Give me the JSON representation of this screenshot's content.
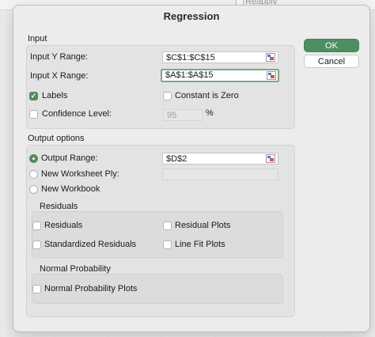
{
  "background": {
    "reapply_label": "Reapply"
  },
  "dialog": {
    "title": "Regression",
    "buttons": {
      "ok": "OK",
      "cancel": "Cancel"
    },
    "input": {
      "section_label": "Input",
      "y_range_label": "Input Y Range:",
      "y_range_value": "$C$1:$C$15",
      "x_range_label": "Input X Range:",
      "x_range_value": "$A$1:$A$15",
      "labels_label": "Labels",
      "labels_checked": true,
      "constant_zero_label": "Constant is Zero",
      "constant_zero_checked": false,
      "confidence_label": "Confidence Level:",
      "confidence_checked": false,
      "confidence_value": "95",
      "percent_sign": "%"
    },
    "output": {
      "section_label": "Output options",
      "output_range_label": "Output Range:",
      "output_range_value": "$D$2",
      "output_range_selected": true,
      "new_ply_label": "New Worksheet Ply:",
      "new_ply_value": "",
      "new_workbook_label": "New Workbook"
    },
    "residuals": {
      "section_label": "Residuals",
      "residuals_label": "Residuals",
      "residual_plots_label": "Residual Plots",
      "standardized_label": "Standardized Residuals",
      "line_fit_label": "Line Fit Plots"
    },
    "normal_probability": {
      "section_label": "Normal Probability",
      "plots_label": "Normal Probability Plots"
    }
  },
  "colors": {
    "accent": "#4e8f62",
    "focus_ring": "#7aa886"
  }
}
